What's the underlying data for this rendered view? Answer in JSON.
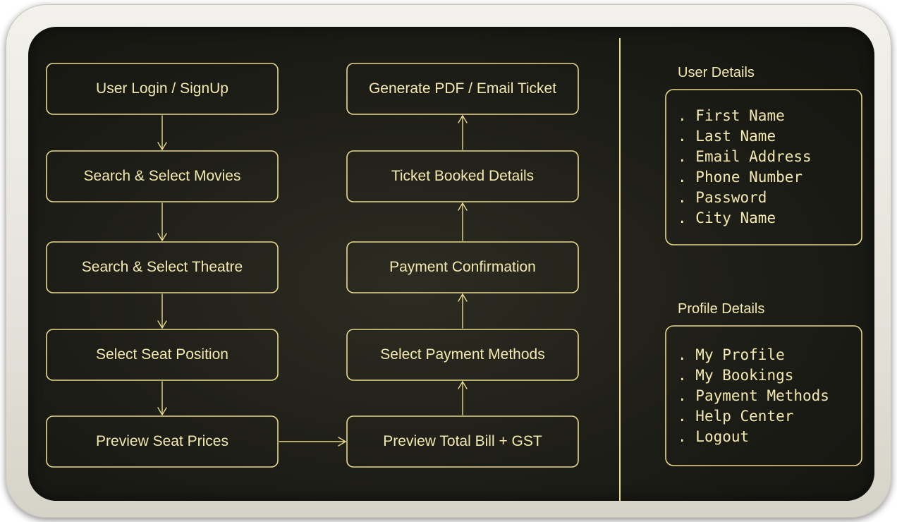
{
  "colors": {
    "background": "#1d1d17",
    "accent": "#e8d98c",
    "text": "#f3e9b0",
    "frame": "#e4e2da"
  },
  "flow": {
    "left_steps": [
      "User Login / SignUp",
      "Search & Select Movies",
      "Search & Select Theatre",
      "Select Seat Position",
      "Preview Seat Prices"
    ],
    "right_steps": [
      "Generate PDF / Email Ticket",
      "Ticket Booked Details",
      "Payment Confirmation",
      "Select Payment Methods",
      "Preview Total Bill + GST"
    ]
  },
  "user_details": {
    "title": "User Details",
    "items": [
      "First Name",
      "Last Name",
      "Email Address",
      "Phone Number",
      "Password",
      "City Name"
    ]
  },
  "profile_details": {
    "title": "Profile Details",
    "items": [
      "My Profile",
      "My Bookings",
      "Payment Methods",
      "Help Center",
      "Logout"
    ]
  }
}
